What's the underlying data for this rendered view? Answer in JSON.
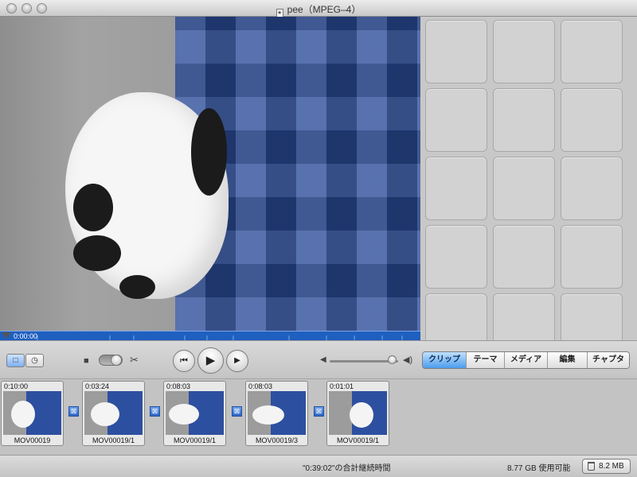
{
  "window": {
    "title": "pee（MPEG–4）",
    "doc_icon": "★"
  },
  "player": {
    "current_time": "0:00:00"
  },
  "controls": {
    "view_clip_icon": "□",
    "view_time_icon": "◷",
    "camera_icon": "■",
    "scissors_icon": "✂",
    "rewind_icon": "⏮",
    "play_icon": "▶",
    "fullscreen_icon": "▶",
    "volume_low_icon": "◀",
    "volume_high_icon": "◀)",
    "volume_level": 0.92
  },
  "tabs": [
    {
      "label": "クリップ",
      "active": true
    },
    {
      "label": "テーマ",
      "active": false
    },
    {
      "label": "メディア",
      "active": false
    },
    {
      "label": "編集",
      "active": false
    },
    {
      "label": "チャプタ",
      "active": false
    }
  ],
  "clips": [
    {
      "duration": "0:10:00",
      "name": "MOV00019"
    },
    {
      "duration": "0:03:24",
      "name": "MOV00019/1"
    },
    {
      "duration": "0:08:03",
      "name": "MOV00019/1"
    },
    {
      "duration": "0:08:03",
      "name": "MOV00019/3"
    },
    {
      "duration": "0:01:01",
      "name": "MOV00019/1"
    }
  ],
  "transition_icon": "⊠",
  "status": {
    "total_duration": "\"0:39:02\"の合計継続時間",
    "free_space": "8.77 GB 使用可能",
    "trash_size": "8.2 MB"
  },
  "colors": {
    "accent_blue": "#4c9ded",
    "scrubber_blue": "#1f5fbf"
  }
}
